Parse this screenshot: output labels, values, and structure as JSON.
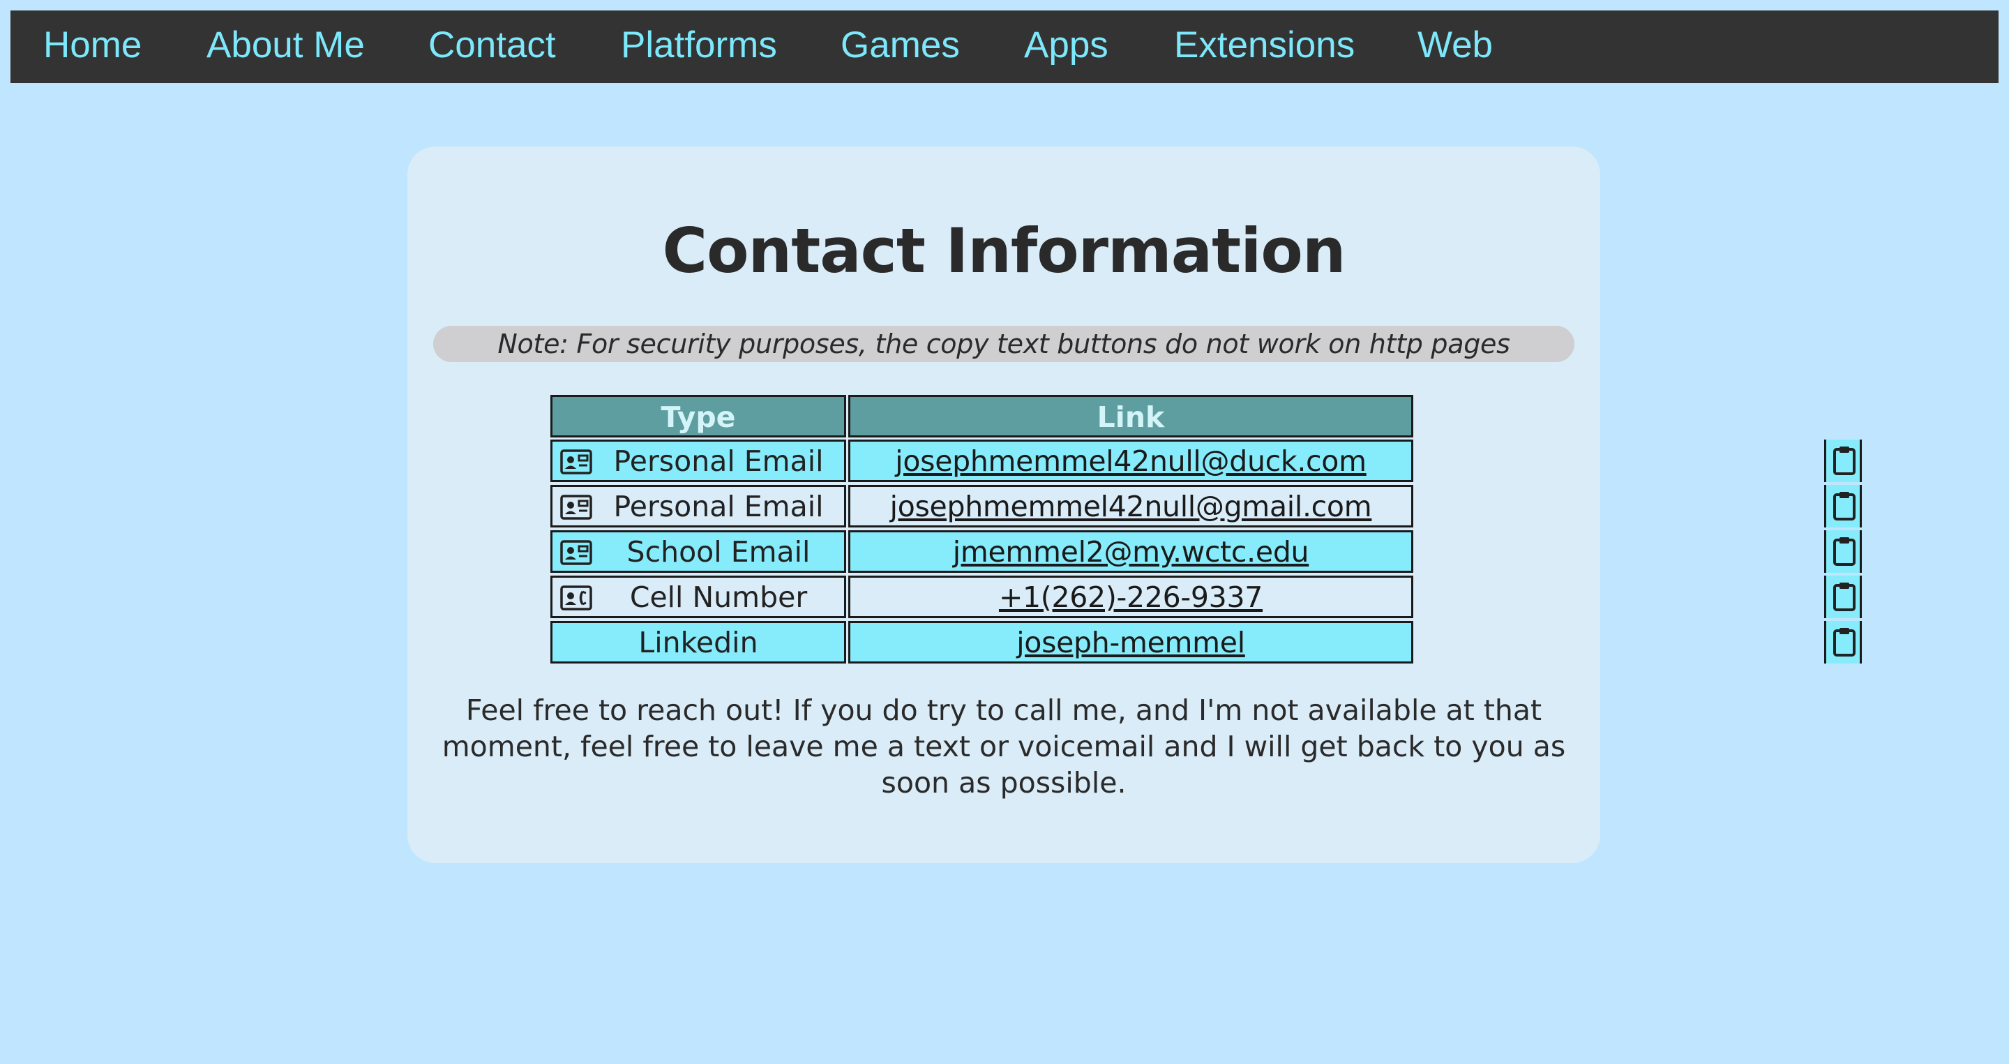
{
  "nav": {
    "items": [
      {
        "label": "Home"
      },
      {
        "label": "About Me"
      },
      {
        "label": "Contact"
      },
      {
        "label": "Platforms"
      },
      {
        "label": "Games"
      },
      {
        "label": "Apps"
      },
      {
        "label": "Extensions"
      },
      {
        "label": "Web"
      }
    ]
  },
  "page": {
    "title": "Contact Information",
    "note": "Note: For security purposes, the copy text buttons do not work on http pages",
    "footer": "Feel free to reach out! If you do try to call me, and I'm not available at that moment, feel free to leave me a text or voicemail and I will get back to you as soon as possible."
  },
  "table": {
    "headers": {
      "type": "Type",
      "link": "Link"
    },
    "rows": [
      {
        "type": "Personal Email",
        "link": "josephmemmel42null@duck.com",
        "icon": "contact-card-icon"
      },
      {
        "type": "Personal Email",
        "link": "josephmemmel42null@gmail.com",
        "icon": "contact-card-icon"
      },
      {
        "type": "School Email",
        "link": "jmemmel2@my.wctc.edu",
        "icon": "contact-card-icon"
      },
      {
        "type": "Cell Number",
        "link": "+1(262)-226-9337",
        "icon": "contact-phone-icon"
      },
      {
        "type": "Linkedin",
        "link": "joseph-memmel",
        "icon": ""
      }
    ],
    "copy_icon": "clipboard-icon"
  },
  "colors": {
    "background": "#bfe6fe",
    "nav_bg": "#333333",
    "nav_text": "#7de8fb",
    "card_bg": "#d9ecf8",
    "header_bg": "#5f9ea0",
    "row_highlight": "#86ecfb"
  }
}
